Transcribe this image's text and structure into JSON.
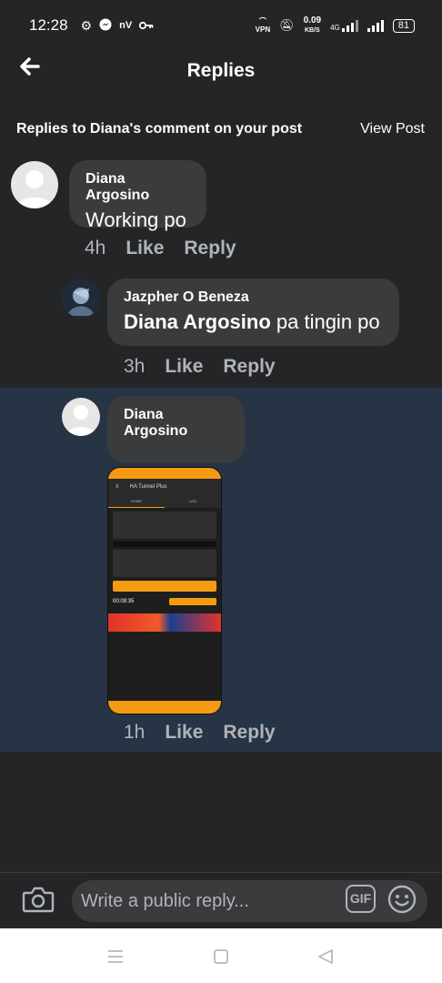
{
  "status_bar": {
    "time": "12:28",
    "left_icons": [
      "gear-icon",
      "messenger-icon",
      "key-icon"
    ],
    "network_label": "nV",
    "speed_value": "0.09",
    "speed_unit": "KB/S",
    "network_type": "4G",
    "vpn_label": "VPN",
    "battery": "81"
  },
  "header": {
    "title": "Replies"
  },
  "subheader": {
    "text": "Replies to Diana's comment on your post",
    "view_post": "View Post"
  },
  "comments": [
    {
      "author": "Diana Argosino",
      "text": "Working po",
      "time": "4h",
      "like": "Like",
      "reply": "Reply"
    },
    {
      "author": "Jazpher O Beneza",
      "mention": "Diana Argosino",
      "text": " pa tingin po",
      "time": "3h",
      "like": "Like",
      "reply": "Reply"
    },
    {
      "author": "Diana Argosino",
      "time": "1h",
      "like": "Like",
      "reply": "Reply",
      "attachment": {
        "app_title": "HA Tunnel Plus",
        "tab1": "HOME",
        "tab2": "LOG",
        "timer": "00:09:35"
      }
    }
  ],
  "composer": {
    "placeholder": "Write a public reply...",
    "gif_label": "GIF"
  },
  "colors": {
    "background": "#242527",
    "bubble": "#3a3b3c",
    "highlight": "#263445",
    "accent_orange": "#f59b12",
    "muted_text": "#b0b3b8"
  }
}
